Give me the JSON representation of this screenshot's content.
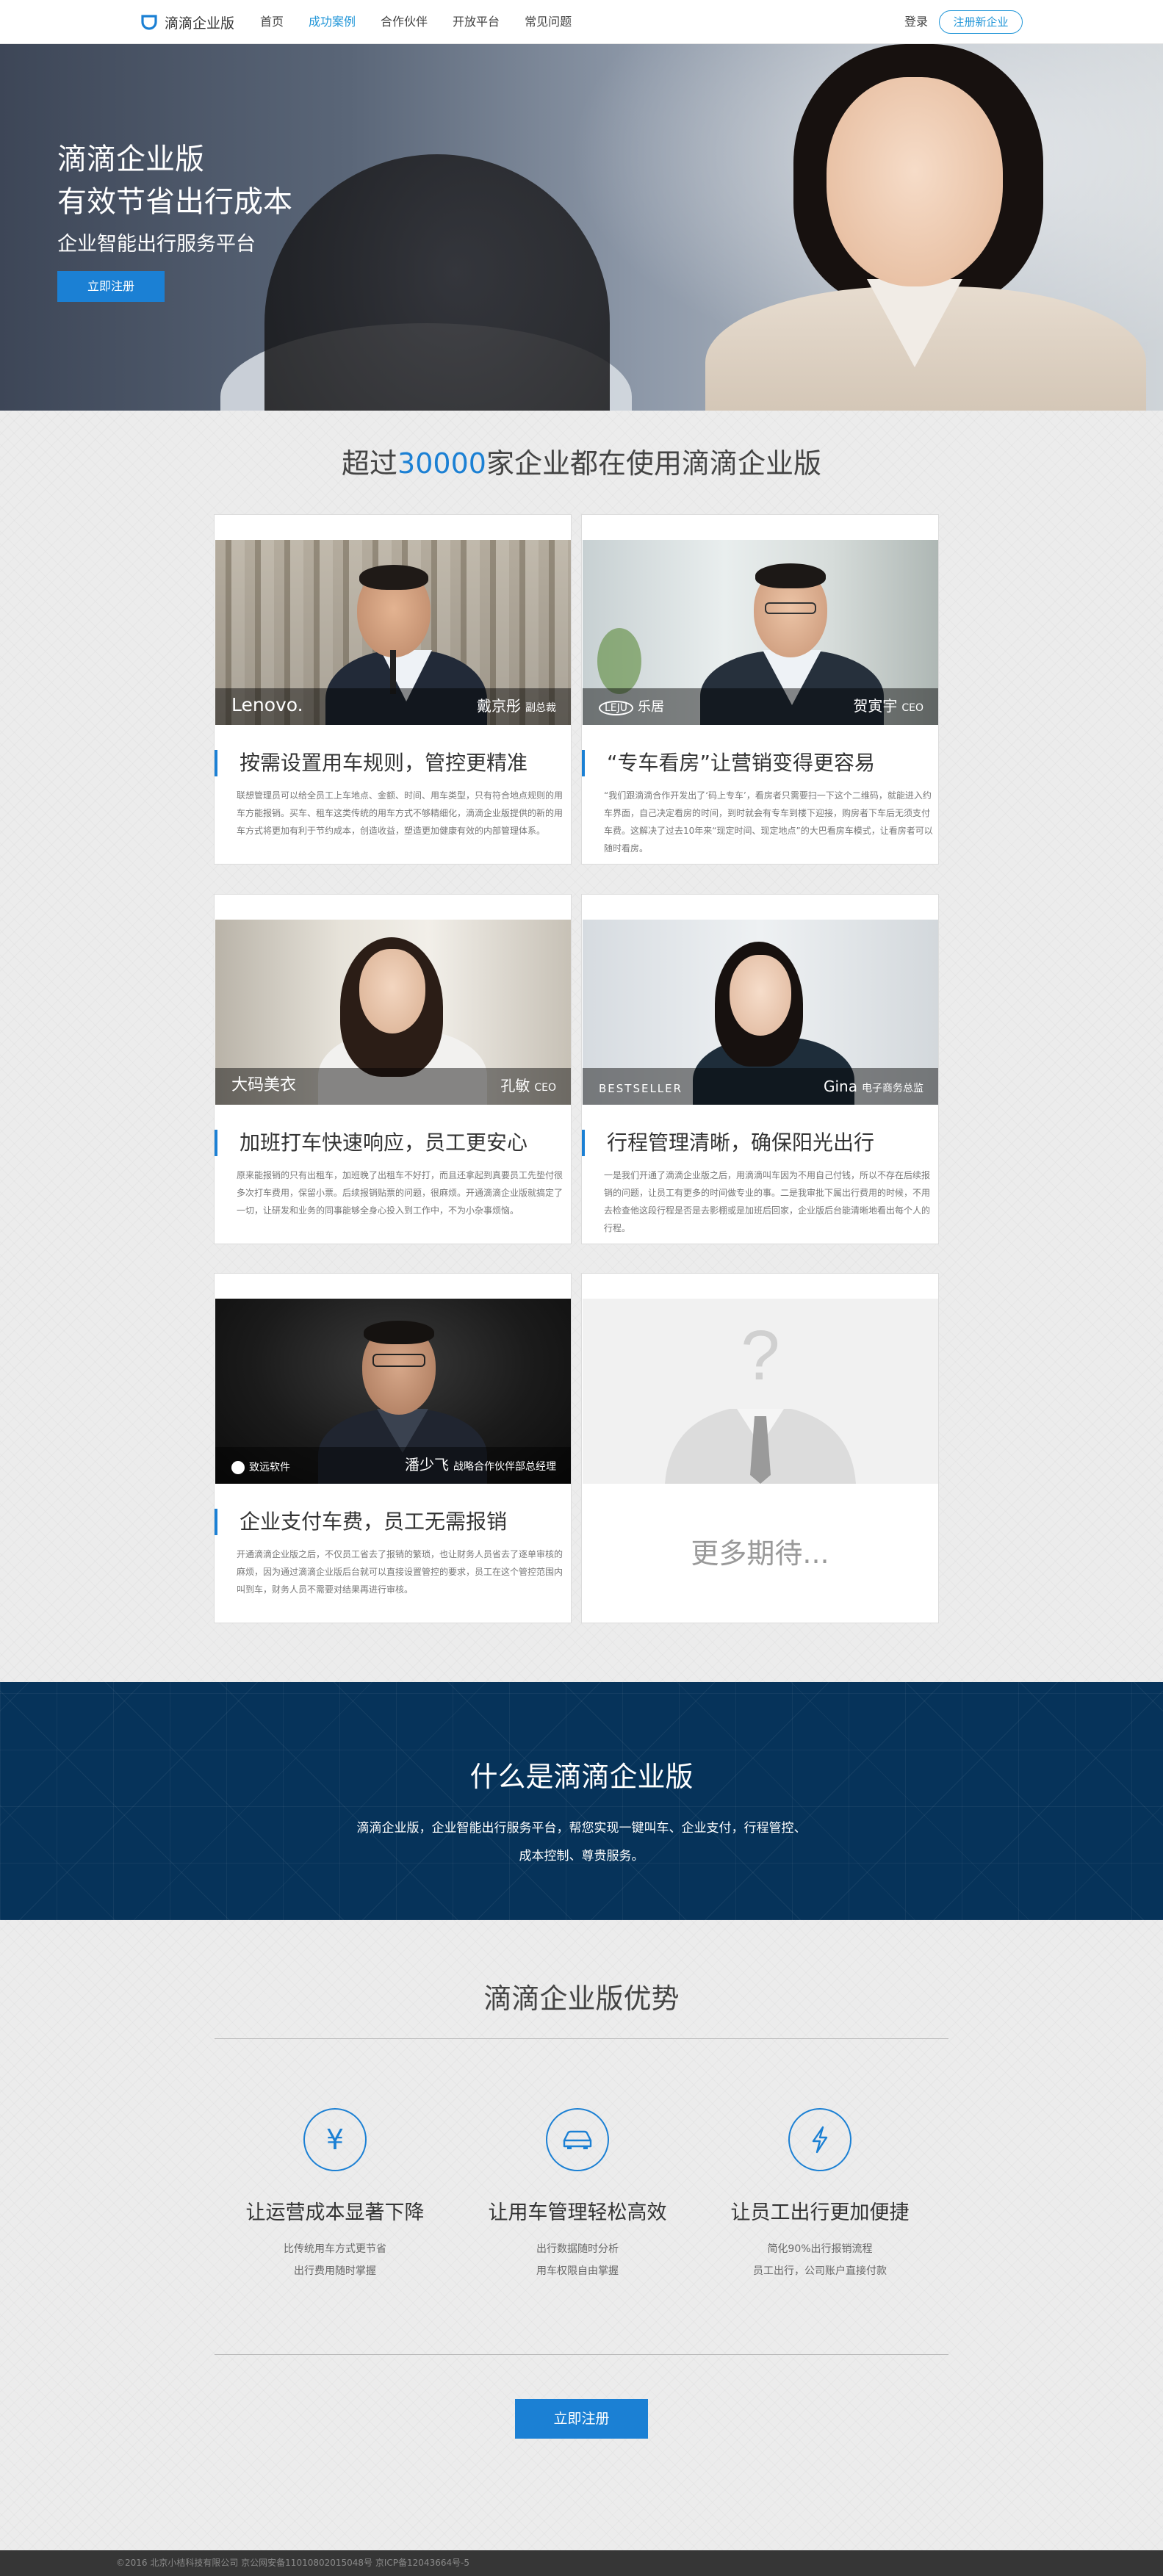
{
  "nav": {
    "brand": "滴滴企业版",
    "items": [
      "首页",
      "成功案例",
      "合作伙伴",
      "开放平台",
      "常见问题"
    ],
    "active_index": 1,
    "login": "登录",
    "register": "注册新企业"
  },
  "hero": {
    "title_line1": "滴滴企业版",
    "title_line2": "有效节省出行成本",
    "subtitle": "企业智能出行服务平台",
    "button": "立即注册"
  },
  "users": {
    "prefix": "超过",
    "count": "30000",
    "suffix": "家企业都在使用滴滴企业版"
  },
  "cases": [
    {
      "brand": "Lenovo.",
      "person": "戴京彤",
      "role": "副总裁",
      "title": "按需设置用车规则，管控更精准",
      "text": "联想管理员可以给全员工上车地点、金额、时间、用车类型，只有符合地点规则的用车方能报销。买车、租车这类传统的用车方式不够精细化，滴滴企业版提供的新的用车方式将更加有利于节约成本，创造收益，塑造更加健康有效的内部管理体系。"
    },
    {
      "brand": "乐居",
      "person": "贺寅宇",
      "role": "CEO",
      "title": "“专车看房”让营销变得更容易",
      "text": "“我们跟滴滴合作开发出了‘码上专车’，看房者只需要扫一下这个二维码，就能进入约车界面，自己决定看房的时间，到时就会有专车到楼下迎接，购房者下车后无须支付车费。这解决了过去10年来“现定时间、现定地点”的大巴看房车模式，让看房者可以随时看房。"
    },
    {
      "brand": "大码美衣",
      "person": "孔敏",
      "role": "CEO",
      "title": "加班打车快速响应，员工更安心",
      "text": "原来能报销的只有出租车，加班晚了出租车不好打，而且还拿起到真要员工先垫付很多次打车费用，保留小票。后续报销贴票的问题，很麻烦。开通滴滴企业版就搞定了一切，让研发和业务的同事能够全身心投入到工作中，不为小杂事烦恼。"
    },
    {
      "brand": "BESTSELLER",
      "person": "Gina",
      "role": "电子商务总监",
      "title": "行程管理清晰，确保阳光出行",
      "text": "一是我们开通了滴滴企业版之后，用滴滴叫车因为不用自己付钱，所以不存在后续报销的问题，让员工有更多的时间做专业的事。二是我审批下属出行费用的时候，不用去检查他这段行程是否是去影棚或是加班后回家，企业版后台能清晰地看出每个人的行程。"
    },
    {
      "brand": "致远软件",
      "person": "潘少飞",
      "role": "战略合作伙伴部总经理",
      "title": "企业支付车费，员工无需报销",
      "text": "开通滴滴企业版之后，不仅员工省去了报销的繁琐，也让财务人员省去了逐单审核的麻烦，因为通过滴滴企业版后台就可以直接设置管控的要求，员工在这个管控范围内叫到车，财务人员不需要对结果再进行审核。"
    }
  ],
  "more": "更多期待...",
  "intro": {
    "title": "什么是滴滴企业版",
    "text_line1": "滴滴企业版，企业智能出行服务平台，帮您实现一键叫车、企业支付，行程管控、",
    "text_line2": "成本控制、尊贵服务。"
  },
  "advantages": {
    "title": "滴滴企业版优势",
    "items": [
      {
        "icon": "yen-icon",
        "glyph": "¥",
        "title": "让运营成本显著下降",
        "desc1": "比传统用车方式更节省",
        "desc2": "出行费用随时掌握"
      },
      {
        "icon": "car-icon",
        "glyph": "",
        "title": "让用车管理轻松高效",
        "desc1": "出行数据随时分析",
        "desc2": "用车权限自由掌握"
      },
      {
        "icon": "lightning-icon",
        "glyph": "",
        "title": "让员工出行更加便捷",
        "desc1": "简化90%出行报销流程",
        "desc2": "员工出行，公司账户直接付款"
      }
    ],
    "button": "立即注册"
  },
  "footer": "©2016 北京小桔科技有限公司 京公网安备11010802015048号 京ICP备12043664号-5",
  "colors": {
    "accent": "#1b80d4",
    "band": "#06335a"
  }
}
